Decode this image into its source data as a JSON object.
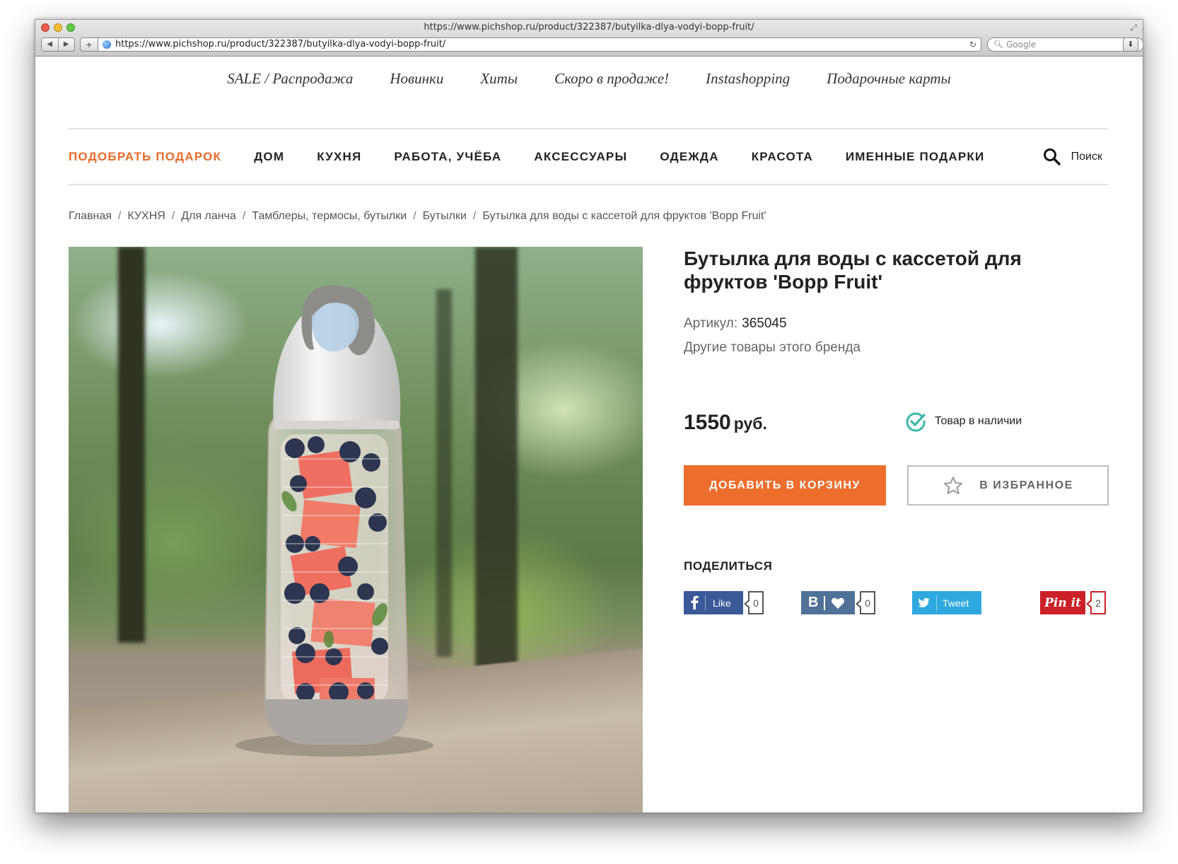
{
  "browser": {
    "title": "https://www.pichshop.ru/product/322387/butyilka-dlya-vodyi-bopp-fruit/",
    "url": "https://www.pichshop.ru/product/322387/butyilka-dlya-vodyi-bopp-fruit/",
    "search_placeholder": "Google"
  },
  "top_nav": [
    "SALE / Распродажа",
    "Новинки",
    "Хиты",
    "Скоро в продаже!",
    "Instashopping",
    "Подарочные карты"
  ],
  "main_nav": {
    "items": [
      "ПОДОБРАТЬ ПОДАРОК",
      "ДОМ",
      "КУХНЯ",
      "РАБОТА, УЧЁБА",
      "АКСЕССУАРЫ",
      "ОДЕЖДА",
      "КРАСОТА",
      "ИМЕННЫЕ ПОДАРКИ"
    ],
    "search_label": "Поиск",
    "accent_color": "#e86a2a"
  },
  "breadcrumb": [
    "Главная",
    "КУХНЯ",
    "Для ланча",
    "Тамблеры, термосы, бутылки",
    "Бутылки",
    "Бутылка для воды с кассетой для фруктов 'Bopp Fruit'"
  ],
  "product": {
    "title": "Бутылка для воды с кассетой для фруктов 'Bopp Fruit'",
    "sku_label": "Артикул:",
    "sku": "365045",
    "brand_link": "Другие товары этого бренда",
    "price": "1550",
    "currency": "руб.",
    "stock": "Товар в наличии",
    "add_to_cart": "ДОБАВИТЬ В КОРЗИНУ",
    "favorite": "В ИЗБРАННОЕ"
  },
  "share": {
    "heading": "ПОДЕЛИТЬСЯ",
    "facebook": {
      "label": "Like",
      "count": "0"
    },
    "vk": {
      "label": "В",
      "count": "0"
    },
    "twitter": {
      "label": "Tweet"
    },
    "pinterest": {
      "label": "Pin it",
      "count": "2"
    }
  },
  "icons": [
    "back-icon",
    "forward-icon",
    "plus-icon",
    "globe-icon",
    "reload-icon",
    "search-icon",
    "download-icon",
    "check-circle-icon",
    "star-icon",
    "facebook-icon",
    "vk-icon",
    "heart-icon",
    "twitter-icon"
  ],
  "colors": {
    "primary_button": "#ec6d2c",
    "stock_check": "#3bb7a8",
    "facebook": "#3b5998",
    "vk": "#507299",
    "twitter": "#2ea8df",
    "pinterest": "#cb2027"
  }
}
